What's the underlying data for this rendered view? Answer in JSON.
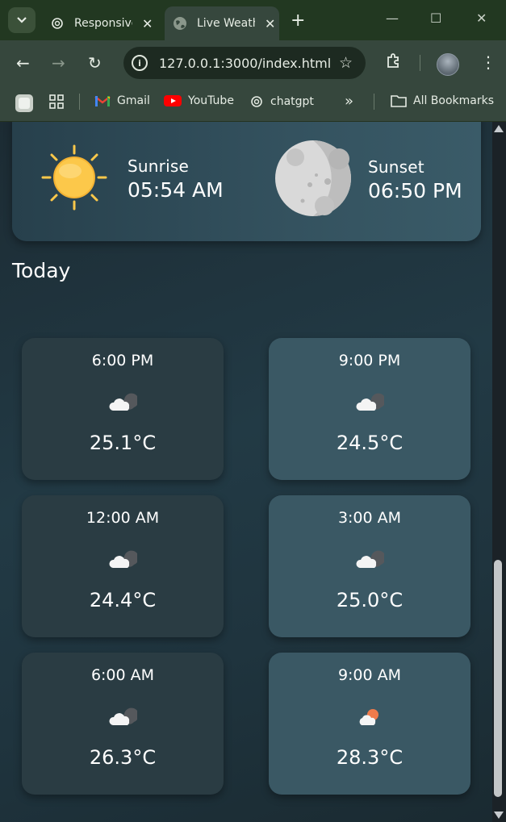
{
  "browser": {
    "tabs": [
      {
        "title": "Responsive",
        "active": false,
        "icon": "chatgpt-icon"
      },
      {
        "title": "Live Weather",
        "active": true,
        "icon": "globe-icon"
      }
    ],
    "url": "127.0.0.1:3000/index.html",
    "bookmarks": [
      {
        "label": "Gmail",
        "icon": "gmail-icon"
      },
      {
        "label": "YouTube",
        "icon": "youtube-icon"
      },
      {
        "label": "chatgpt",
        "icon": "chatgpt-icon"
      }
    ],
    "all_bookmarks_label": "All Bookmarks",
    "overflow_label": "»"
  },
  "sun": {
    "sunrise": {
      "label": "Sunrise",
      "time": "05:54 AM",
      "icon": "sun-icon"
    },
    "sunset": {
      "label": "Sunset",
      "time": "06:50 PM",
      "icon": "moon-icon"
    }
  },
  "today": {
    "heading": "Today",
    "hours": [
      {
        "time": "6:00 PM",
        "temp": "25.1°C",
        "icon": "cloudy-night-icon"
      },
      {
        "time": "9:00 PM",
        "temp": "24.5°C",
        "icon": "cloudy-night-icon"
      },
      {
        "time": "12:00 AM",
        "temp": "24.4°C",
        "icon": "cloudy-night-icon"
      },
      {
        "time": "3:00 AM",
        "temp": "25.0°C",
        "icon": "cloudy-night-icon"
      },
      {
        "time": "6:00 AM",
        "temp": "26.3°C",
        "icon": "cloudy-night-icon"
      },
      {
        "time": "9:00 AM",
        "temp": "28.3°C",
        "icon": "partly-cloudy-day-icon"
      }
    ]
  },
  "colors": {
    "chrome": "#36473d",
    "tabbar": "#223821",
    "sun": "#fcc84a"
  }
}
